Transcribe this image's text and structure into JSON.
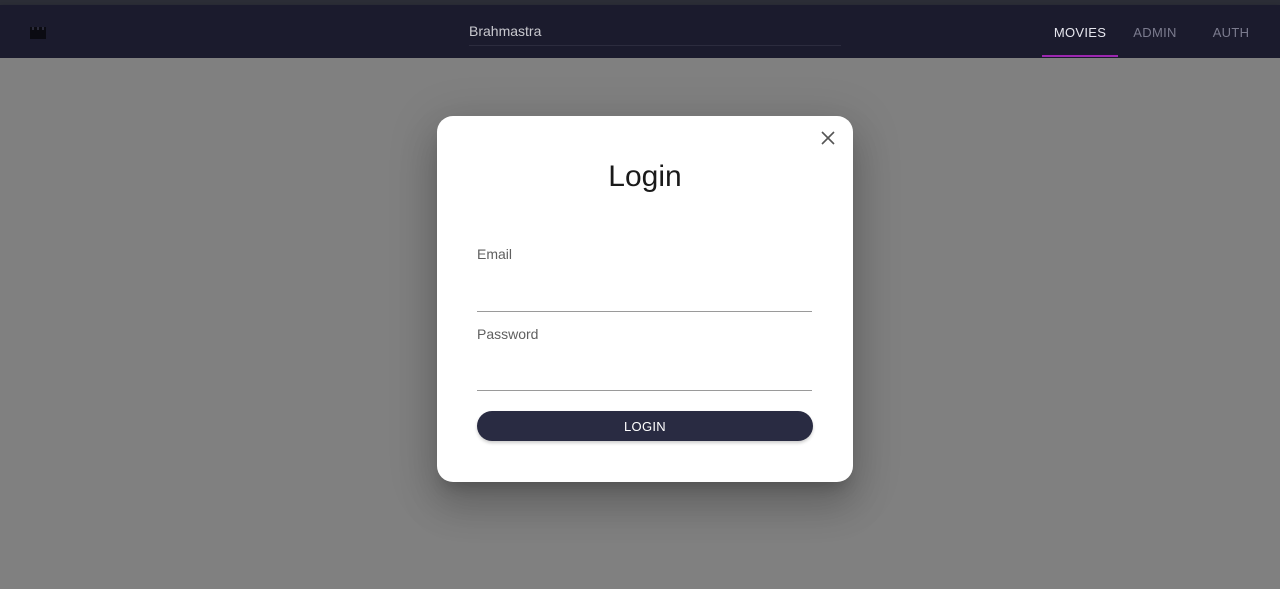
{
  "app": {
    "search_value": "Brahmastra",
    "nav_tabs": [
      {
        "label": "MOVIES",
        "active": true
      },
      {
        "label": "ADMIN",
        "active": false
      },
      {
        "label": "AUTH",
        "active": false
      }
    ],
    "colors": {
      "appbar": "#1b1b2d",
      "tab_indicator": "#9c27b0",
      "button": "#292b42",
      "overlay": "#808080"
    },
    "icons": {
      "logo": "film-clapper-icon",
      "close": "close-icon"
    }
  },
  "login_dialog": {
    "title": "Login",
    "email_label": "Email",
    "email_value": "",
    "password_label": "Password",
    "password_value": "",
    "submit_label": "LOGIN"
  }
}
